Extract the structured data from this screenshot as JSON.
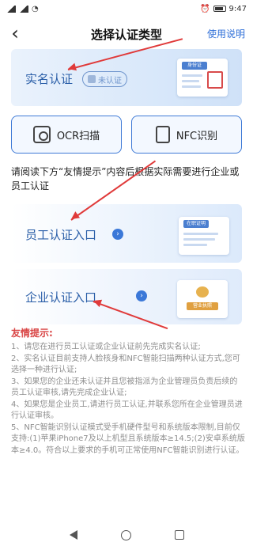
{
  "status_bar": {
    "time": "9:47"
  },
  "header": {
    "back_icon": "chevron-left-icon",
    "title": "选择认证类型",
    "help": "使用说明"
  },
  "realname": {
    "label": "实名认证",
    "badge": "未认证",
    "card_header": "身份证"
  },
  "buttons": {
    "ocr": "OCR扫描",
    "nfc": "NFC识别"
  },
  "intro": "请阅读下方“友情提示”内容后根据实际需要进行企业或员工认证",
  "employee": {
    "label": "员工认证入口",
    "card_header": "在职证明"
  },
  "company": {
    "label": "企业认证入口",
    "card_header": "营业执照"
  },
  "tips": {
    "title": "友情提示:",
    "items": [
      "1、请您在进行员工认证或企业认证前先完成实名认证;",
      "2、实名认证目前支持人脸核身和NFC智能扫描两种认证方式,您可选择一种进行认证;",
      "3、如果您的企业还未认证并且您被指派为企业管理员负责后续的员工认证审核,请先完成企业认证;",
      "4、如果您是企业员工,请进行员工认证,并联系您所在企业管理员进行认证审核。",
      "5、NFC智能识别认证模式受手机硬件型号和系统版本限制,目前仅支持:(1)苹果iPhone7及以上机型且系统版本≥14.5;(2)安卓系统版本≥4.0。符合以上要求的手机可正常使用NFC智能识别进行认证。"
    ]
  },
  "colors": {
    "accent": "#3b78d8",
    "tip_title": "#d94545",
    "arrow": "#e03a3a"
  }
}
